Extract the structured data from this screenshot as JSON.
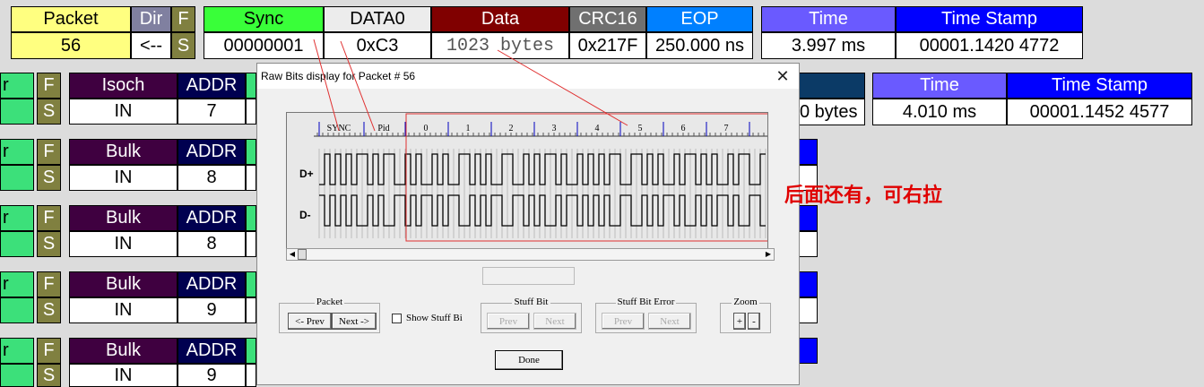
{
  "top_row": {
    "headers": {
      "packet": "Packet",
      "dir": "Dir",
      "f": "F",
      "sync": "Sync",
      "data0": "DATA0",
      "data": "Data",
      "crc16": "CRC16",
      "eop": "EOP",
      "time": "Time",
      "timestamp": "Time Stamp"
    },
    "values": {
      "packet": "56",
      "dir": "<--",
      "s": "S",
      "sync": "00000001",
      "data0": "0xC3",
      "data": "1023 bytes",
      "crc16": "0x217F",
      "eop": "250.000 ns",
      "time": "3.997 ms",
      "timestamp": "00001.1420 4772"
    }
  },
  "rows": [
    {
      "r": "r",
      "f": "F",
      "s": "S",
      "type": "Isoch",
      "addr_label": "ADDR",
      "dir": "IN",
      "addr": "7",
      "extra": "0 bytes",
      "time_h": "Time",
      "ts_h": "Time Stamp",
      "time": "4.010 ms",
      "ts": "00001.1452 4577"
    },
    {
      "r": "r",
      "f": "F",
      "s": "S",
      "type": "Bulk",
      "addr_label": "ADDR",
      "dir": "IN",
      "addr": "8"
    },
    {
      "r": "r",
      "f": "F",
      "s": "S",
      "type": "Bulk",
      "addr_label": "ADDR",
      "dir": "IN",
      "addr": "8"
    },
    {
      "r": "r",
      "f": "F",
      "s": "S",
      "type": "Bulk",
      "addr_label": "ADDR",
      "dir": "IN",
      "addr": "9"
    },
    {
      "r": "r",
      "f": "F",
      "s": "S",
      "type": "Bulk",
      "addr_label": "ADDR",
      "dir": "IN",
      "addr": "9"
    }
  ],
  "dialog": {
    "title": "Raw Bits display for Packet # 56",
    "close": "✕",
    "ruler_labels": [
      "SYNC",
      "Pid",
      "0",
      "1",
      "2",
      "3",
      "4",
      "5",
      "6",
      "7"
    ],
    "dplus": "D+",
    "dminus": "D-",
    "annotation": "后面还有，可右拉",
    "groups": {
      "packet": {
        "label": "Packet",
        "prev": "<- Prev",
        "next": "Next ->"
      },
      "show_stuff": "Show Stuff Bi",
      "stuff_bit": {
        "label": "Stuff Bit",
        "prev": "Prev",
        "next": "Next"
      },
      "stuff_err": {
        "label": "Stuff Bit Error",
        "prev": "Prev",
        "next": "Next"
      },
      "zoom": {
        "label": "Zoom",
        "plus": "+",
        "minus": "-"
      }
    },
    "done": "Done"
  },
  "colors": {
    "packet_hdr": "#ffff80",
    "dir_hdr": "#8080a0",
    "f_hdr": "#808040",
    "sync_hdr": "#39ff39",
    "data0_hdr": "#ececec",
    "data_hdr": "#800000",
    "crc_hdr": "#707070",
    "eop_hdr": "#0080ff",
    "time_hdr": "#6a5aff",
    "ts_hdr": "#0000ff",
    "field_green": "#3ce07a",
    "type_hdr": "#3f0040",
    "addr_hdr": "#000050",
    "annotation": "#e00000"
  }
}
